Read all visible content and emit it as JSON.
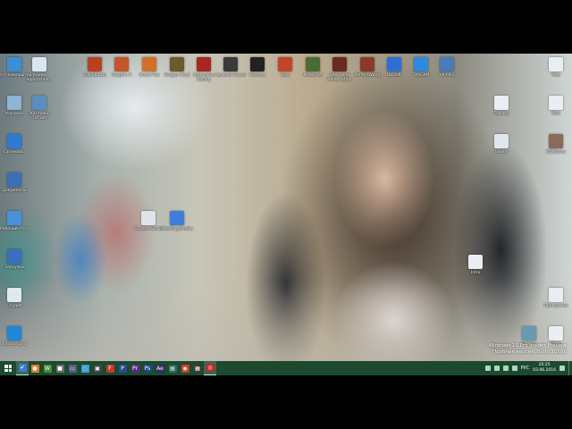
{
  "desktop": {
    "icons": [
      {
        "name": "computer-icon",
        "label": "Этот компьютер",
        "color": "#3b8fd6"
      },
      {
        "name": "adobe-icon",
        "label": "Adobe Application...",
        "color": "#d9e6f2"
      },
      {
        "name": "recycle-bin-icon",
        "label": "Корзина",
        "color": "#8fb4d6"
      },
      {
        "name": "microsoft-edge-icon",
        "label": "360 точно Тотаоп",
        "color": "#5a8ec0"
      },
      {
        "name": "text-file-icon",
        "label": "Оргиналы",
        "color": "#2e7bd1"
      },
      {
        "name": "file-icon-1",
        "label": "Документы",
        "color": "#3b6fb5"
      },
      {
        "name": "file-icon-2",
        "label": "Рабочий стол",
        "color": "#4a90d9"
      },
      {
        "name": "file-icon-3",
        "label": "Загрузки",
        "color": "#3a6fc0"
      },
      {
        "name": "folder-icon-1",
        "label": "Студия",
        "color": "#dfe9f2"
      },
      {
        "name": "gem-icon",
        "label": "Bitcoin Gold",
        "color": "#1e88d8"
      },
      {
        "name": "game-icon-1",
        "label": "ClashBattle",
        "color": "#b8421f"
      },
      {
        "name": "game-icon-2",
        "label": "Graphic X",
        "color": "#c4562b"
      },
      {
        "name": "game-icon-3",
        "label": "Green Fox",
        "color": "#d2702a"
      },
      {
        "name": "game-icon-4",
        "label": "Dragon Nest",
        "color": "#6b5a2a"
      },
      {
        "name": "game-icon-5",
        "label": "Adrenaline Racing",
        "color": "#a8281f"
      },
      {
        "name": "game-icon-6",
        "label": "Assassin Creed",
        "color": "#3a3a3a"
      },
      {
        "name": "warface-icon",
        "label": "Warface",
        "color": "#222222"
      },
      {
        "name": "rust-icon",
        "label": "Rust",
        "color": "#c0452a"
      },
      {
        "name": "minecraft-icon",
        "label": "Minecraft",
        "color": "#4b6b34"
      },
      {
        "name": "game-icon-7",
        "label": "Red Dead Redemption",
        "color": "#6a2a24"
      },
      {
        "name": "game-icon-8",
        "label": "PerfectWorld",
        "color": "#8a3a2a"
      },
      {
        "name": "app-icon-1",
        "label": "Ubisoft",
        "color": "#2d6fd6"
      },
      {
        "name": "app-icon-2",
        "label": "TASCAM",
        "color": "#2c8be0"
      },
      {
        "name": "app-icon-3",
        "label": "VK MP3",
        "color": "#4a7ab8"
      },
      {
        "name": "file-icon-4",
        "label": "Моё",
        "color": "#e8eef4"
      },
      {
        "name": "file-icon-5",
        "label": "Моё",
        "color": "#e8eef4"
      },
      {
        "name": "file-icon-6",
        "label": "Ссылка",
        "color": "#e8eef4"
      },
      {
        "name": "file-icon-7",
        "label": "tokens",
        "color": "#dfe6ee"
      },
      {
        "name": "gallery-icon",
        "label": "KOMkoins",
        "color": "#8a6a5a"
      },
      {
        "name": "center-file-icon-1",
        "label": "Counter-Strike",
        "color": "#e0e4ea"
      },
      {
        "name": "center-file-icon-2",
        "label": "WebKingsPeaks",
        "color": "#3d7fd8"
      },
      {
        "name": "file-icon-8",
        "label": "Intro",
        "color": "#e8eef4"
      },
      {
        "name": "file-icon-9",
        "label": "Программа",
        "color": "#e8eef4"
      },
      {
        "name": "file-icon-10",
        "label": "Бизнес",
        "color": "#6a9ab0"
      },
      {
        "name": "file-icon-11",
        "label": "Фото",
        "color": "#e8eef4"
      }
    ],
    "watermark": {
      "line1": "Windows 10 Pro Insider Preview",
      "line2": "Пробная версия. Build 10586"
    }
  },
  "taskbar": {
    "apps": [
      {
        "name": "tb-app-1",
        "glyph": "✔",
        "color": "#3a7bd5",
        "active": true
      },
      {
        "name": "tb-app-2",
        "glyph": "●",
        "color": "#e07a2a",
        "active": false
      },
      {
        "name": "tb-app-3",
        "glyph": "W",
        "color": "#4a8a3a",
        "active": false
      },
      {
        "name": "tb-app-4",
        "glyph": "■",
        "color": "#6a6a6a",
        "active": false
      },
      {
        "name": "tb-app-5",
        "glyph": "▭",
        "color": "#5a5a8a",
        "active": false
      },
      {
        "name": "tb-app-6",
        "glyph": "○",
        "color": "#3a9ad0",
        "active": false
      },
      {
        "name": "tb-app-7",
        "glyph": "▣",
        "color": "#444444",
        "active": false
      },
      {
        "name": "tb-app-8",
        "glyph": "F",
        "color": "#c43a2a",
        "active": false
      },
      {
        "name": "tb-app-9",
        "glyph": "P",
        "color": "#2a4a9a",
        "active": false
      },
      {
        "name": "tb-app-10",
        "glyph": "Pr",
        "color": "#5a2a8a",
        "active": false
      },
      {
        "name": "tb-app-11",
        "glyph": "Ps",
        "color": "#1a4a7a",
        "active": false
      },
      {
        "name": "tb-app-12",
        "glyph": "Ae",
        "color": "#3a2a6a",
        "active": false
      },
      {
        "name": "tb-app-13",
        "glyph": "▤",
        "color": "#2a6a5a",
        "active": false
      },
      {
        "name": "tb-app-14",
        "glyph": "◉",
        "color": "#d03a2a",
        "active": false
      },
      {
        "name": "tb-app-15",
        "glyph": "▦",
        "color": "#3a3a3a",
        "active": false
      },
      {
        "name": "tb-app-16",
        "glyph": "◎",
        "color": "#c02a2a",
        "active": true
      }
    ],
    "language": "РУС",
    "time": "20:25",
    "date": "03.06.2016"
  }
}
